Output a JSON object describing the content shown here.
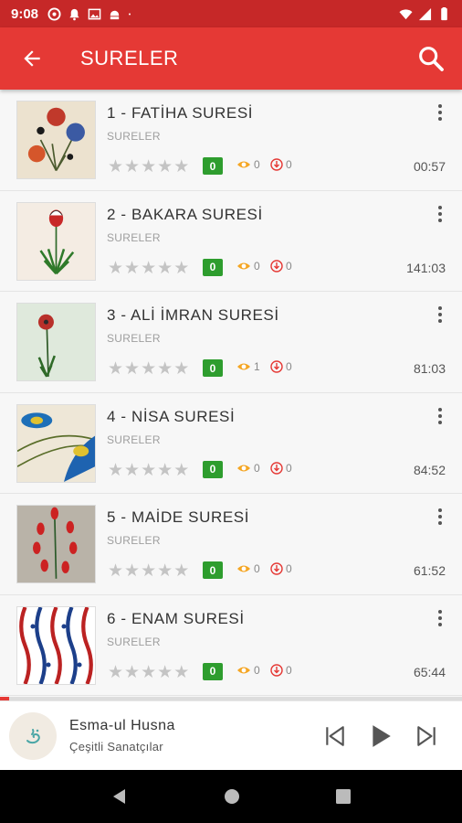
{
  "status_bar": {
    "time": "9:08"
  },
  "app_bar": {
    "title": "SURELER"
  },
  "rows": [
    {
      "name": "1 - FATİHA SURESİ",
      "category": "SURELER",
      "badge": "0",
      "views": "0",
      "downloads": "0",
      "duration": "00:57",
      "rating": 0,
      "art": "carnation-bouquet"
    },
    {
      "name": "2 - BAKARA SURESİ",
      "category": "SURELER",
      "badge": "0",
      "views": "0",
      "downloads": "0",
      "duration": "141:03",
      "rating": 0,
      "art": "tulip-stem"
    },
    {
      "name": "3 - ALİ İMRAN SURESİ",
      "category": "SURELER",
      "badge": "0",
      "views": "1",
      "downloads": "0",
      "duration": "81:03",
      "rating": 0,
      "art": "poppy"
    },
    {
      "name": "4 - NİSA SURESİ",
      "category": "SURELER",
      "badge": "0",
      "views": "0",
      "downloads": "0",
      "duration": "84:52",
      "rating": 0,
      "art": "peacock-feather"
    },
    {
      "name": "5 - MAİDE SURESİ",
      "category": "SURELER",
      "badge": "0",
      "views": "0",
      "downloads": "0",
      "duration": "61:52",
      "rating": 0,
      "art": "red-tulips"
    },
    {
      "name": "6 - ENAM SURESİ",
      "category": "SURELER",
      "badge": "0",
      "views": "0",
      "downloads": "0",
      "duration": "65:44",
      "rating": 0,
      "art": "tile-pattern"
    }
  ],
  "player": {
    "title": "Esma-ul Husna",
    "artist": "Çeşitli Sanatçılar",
    "progress": 0.02
  },
  "colors": {
    "status_bar": "#c62828",
    "app_bar": "#e53935",
    "badge": "#2e9d2e",
    "view_icon": "#f5a623",
    "download_icon": "#e53935"
  }
}
